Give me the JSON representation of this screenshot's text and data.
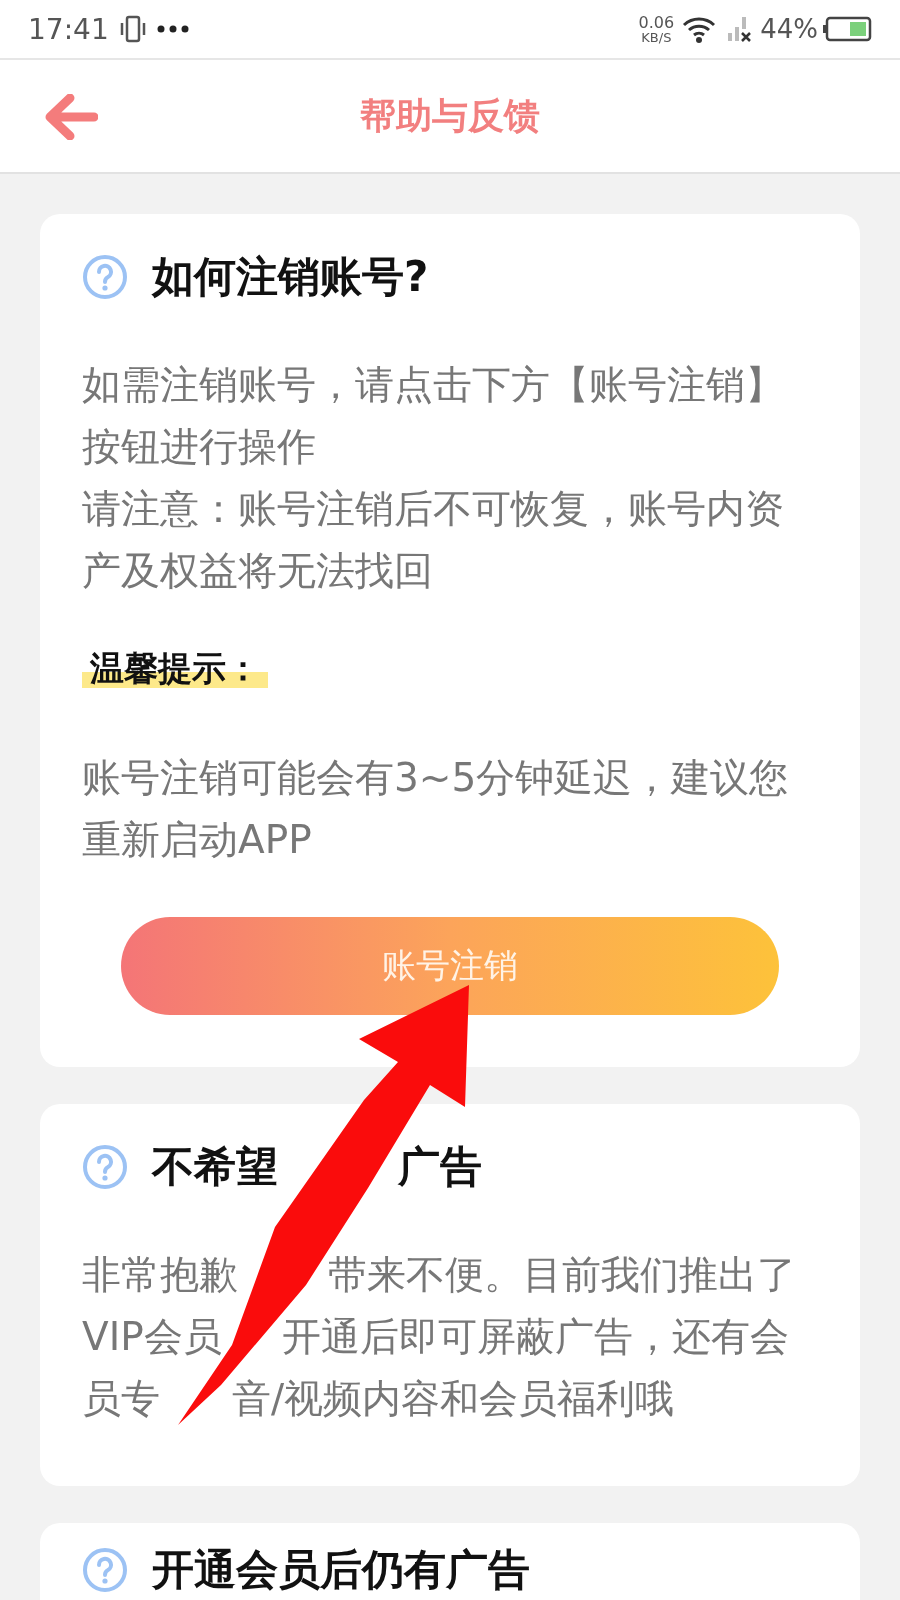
{
  "status_bar": {
    "time": "17:41",
    "net_speed": "0.06",
    "net_unit": "KB/S",
    "battery": "44%"
  },
  "header": {
    "title": "帮助与反馈"
  },
  "cards": [
    {
      "title_parts": [
        "如何注销账号?"
      ],
      "paragraphs": [
        "如需注销账号，请点击下方【账号注销】按钮进行操作",
        "请注意：账号注销后不可恢复，账号内资产及权益将无法找回"
      ],
      "hint": "温馨提示：",
      "note": "账号注销可能会有3~5分钟延迟，建议您重新启动APP",
      "button": "账号注销"
    },
    {
      "title_parts": [
        "不希望",
        "广告"
      ],
      "lines": [
        [
          "非常抱歉",
          "带来不便。目前我们推出了"
        ],
        [
          "VIP会员",
          "开通后即可屏蔽广告，还有会"
        ],
        [
          "员专",
          "音/视频内容和会员福利哦"
        ]
      ]
    },
    {
      "title_parts": [
        "开通会员后仍有广告"
      ]
    }
  ]
}
